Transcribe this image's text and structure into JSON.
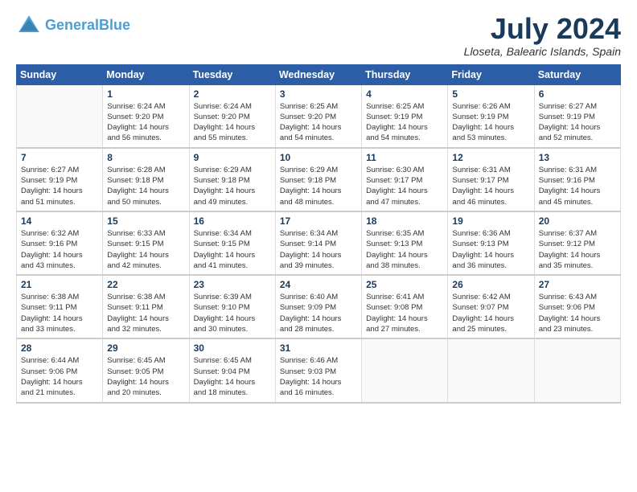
{
  "header": {
    "logo_line1": "General",
    "logo_line2": "Blue",
    "month_title": "July 2024",
    "location": "Lloseta, Balearic Islands, Spain"
  },
  "days_of_week": [
    "Sunday",
    "Monday",
    "Tuesday",
    "Wednesday",
    "Thursday",
    "Friday",
    "Saturday"
  ],
  "weeks": [
    [
      {
        "day": "",
        "info": ""
      },
      {
        "day": "1",
        "info": "Sunrise: 6:24 AM\nSunset: 9:20 PM\nDaylight: 14 hours\nand 56 minutes."
      },
      {
        "day": "2",
        "info": "Sunrise: 6:24 AM\nSunset: 9:20 PM\nDaylight: 14 hours\nand 55 minutes."
      },
      {
        "day": "3",
        "info": "Sunrise: 6:25 AM\nSunset: 9:20 PM\nDaylight: 14 hours\nand 54 minutes."
      },
      {
        "day": "4",
        "info": "Sunrise: 6:25 AM\nSunset: 9:19 PM\nDaylight: 14 hours\nand 54 minutes."
      },
      {
        "day": "5",
        "info": "Sunrise: 6:26 AM\nSunset: 9:19 PM\nDaylight: 14 hours\nand 53 minutes."
      },
      {
        "day": "6",
        "info": "Sunrise: 6:27 AM\nSunset: 9:19 PM\nDaylight: 14 hours\nand 52 minutes."
      }
    ],
    [
      {
        "day": "7",
        "info": "Sunrise: 6:27 AM\nSunset: 9:19 PM\nDaylight: 14 hours\nand 51 minutes."
      },
      {
        "day": "8",
        "info": "Sunrise: 6:28 AM\nSunset: 9:18 PM\nDaylight: 14 hours\nand 50 minutes."
      },
      {
        "day": "9",
        "info": "Sunrise: 6:29 AM\nSunset: 9:18 PM\nDaylight: 14 hours\nand 49 minutes."
      },
      {
        "day": "10",
        "info": "Sunrise: 6:29 AM\nSunset: 9:18 PM\nDaylight: 14 hours\nand 48 minutes."
      },
      {
        "day": "11",
        "info": "Sunrise: 6:30 AM\nSunset: 9:17 PM\nDaylight: 14 hours\nand 47 minutes."
      },
      {
        "day": "12",
        "info": "Sunrise: 6:31 AM\nSunset: 9:17 PM\nDaylight: 14 hours\nand 46 minutes."
      },
      {
        "day": "13",
        "info": "Sunrise: 6:31 AM\nSunset: 9:16 PM\nDaylight: 14 hours\nand 45 minutes."
      }
    ],
    [
      {
        "day": "14",
        "info": "Sunrise: 6:32 AM\nSunset: 9:16 PM\nDaylight: 14 hours\nand 43 minutes."
      },
      {
        "day": "15",
        "info": "Sunrise: 6:33 AM\nSunset: 9:15 PM\nDaylight: 14 hours\nand 42 minutes."
      },
      {
        "day": "16",
        "info": "Sunrise: 6:34 AM\nSunset: 9:15 PM\nDaylight: 14 hours\nand 41 minutes."
      },
      {
        "day": "17",
        "info": "Sunrise: 6:34 AM\nSunset: 9:14 PM\nDaylight: 14 hours\nand 39 minutes."
      },
      {
        "day": "18",
        "info": "Sunrise: 6:35 AM\nSunset: 9:13 PM\nDaylight: 14 hours\nand 38 minutes."
      },
      {
        "day": "19",
        "info": "Sunrise: 6:36 AM\nSunset: 9:13 PM\nDaylight: 14 hours\nand 36 minutes."
      },
      {
        "day": "20",
        "info": "Sunrise: 6:37 AM\nSunset: 9:12 PM\nDaylight: 14 hours\nand 35 minutes."
      }
    ],
    [
      {
        "day": "21",
        "info": "Sunrise: 6:38 AM\nSunset: 9:11 PM\nDaylight: 14 hours\nand 33 minutes."
      },
      {
        "day": "22",
        "info": "Sunrise: 6:38 AM\nSunset: 9:11 PM\nDaylight: 14 hours\nand 32 minutes."
      },
      {
        "day": "23",
        "info": "Sunrise: 6:39 AM\nSunset: 9:10 PM\nDaylight: 14 hours\nand 30 minutes."
      },
      {
        "day": "24",
        "info": "Sunrise: 6:40 AM\nSunset: 9:09 PM\nDaylight: 14 hours\nand 28 minutes."
      },
      {
        "day": "25",
        "info": "Sunrise: 6:41 AM\nSunset: 9:08 PM\nDaylight: 14 hours\nand 27 minutes."
      },
      {
        "day": "26",
        "info": "Sunrise: 6:42 AM\nSunset: 9:07 PM\nDaylight: 14 hours\nand 25 minutes."
      },
      {
        "day": "27",
        "info": "Sunrise: 6:43 AM\nSunset: 9:06 PM\nDaylight: 14 hours\nand 23 minutes."
      }
    ],
    [
      {
        "day": "28",
        "info": "Sunrise: 6:44 AM\nSunset: 9:06 PM\nDaylight: 14 hours\nand 21 minutes."
      },
      {
        "day": "29",
        "info": "Sunrise: 6:45 AM\nSunset: 9:05 PM\nDaylight: 14 hours\nand 20 minutes."
      },
      {
        "day": "30",
        "info": "Sunrise: 6:45 AM\nSunset: 9:04 PM\nDaylight: 14 hours\nand 18 minutes."
      },
      {
        "day": "31",
        "info": "Sunrise: 6:46 AM\nSunset: 9:03 PM\nDaylight: 14 hours\nand 16 minutes."
      },
      {
        "day": "",
        "info": ""
      },
      {
        "day": "",
        "info": ""
      },
      {
        "day": "",
        "info": ""
      }
    ]
  ]
}
